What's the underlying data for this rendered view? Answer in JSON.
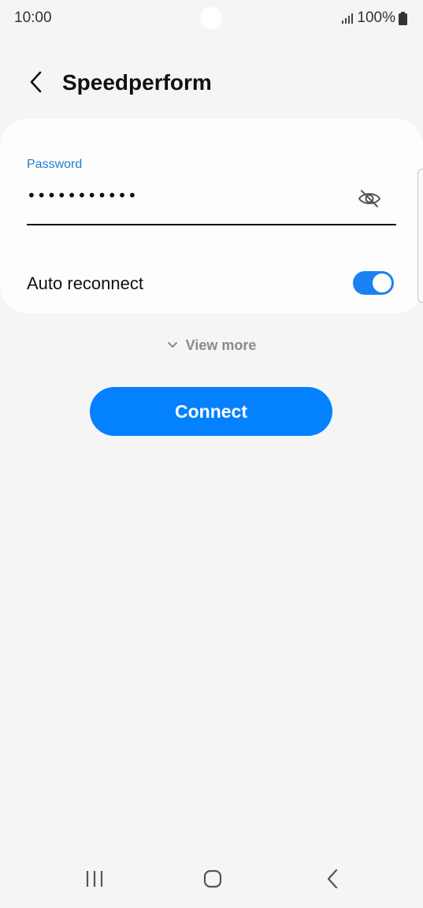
{
  "status_bar": {
    "time": "10:00",
    "battery": "100%",
    "signal_icon": "signal-icon",
    "battery_icon": "battery-icon"
  },
  "header": {
    "title": "Speedperform",
    "back_icon": "chevron-left-icon"
  },
  "form": {
    "password_label": "Password",
    "password_value": "•••••••••••",
    "visibility_icon": "eye-off-icon",
    "auto_reconnect_label": "Auto reconnect",
    "auto_reconnect_on": true
  },
  "view_more": {
    "label": "View more",
    "icon": "chevron-down-icon"
  },
  "connect": {
    "label": "Connect"
  },
  "nav": {
    "recents_icon": "recents-icon",
    "home_icon": "home-icon",
    "back_icon": "back-icon"
  },
  "colors": {
    "accent": "#0381fe",
    "label_blue": "#1a7fd6",
    "background": "#f5f5f5",
    "card": "#fdfdfd"
  }
}
